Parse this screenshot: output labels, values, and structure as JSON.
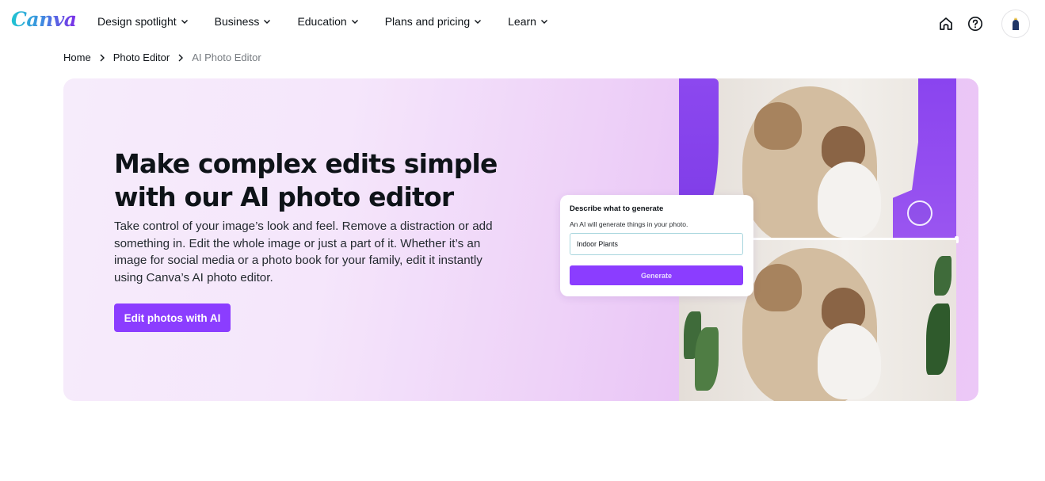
{
  "brand": {
    "logo_text": "Canva",
    "accent_color": "#8b3dff"
  },
  "nav": {
    "items": [
      {
        "label": "Design spotlight"
      },
      {
        "label": "Business"
      },
      {
        "label": "Education"
      },
      {
        "label": "Plans and pricing"
      },
      {
        "label": "Learn"
      }
    ],
    "right_icons": [
      "home-icon",
      "help-icon",
      "avatar"
    ]
  },
  "breadcrumb": {
    "items": [
      {
        "label": "Home"
      },
      {
        "label": "Photo Editor"
      },
      {
        "label": "AI Photo Editor"
      }
    ]
  },
  "hero": {
    "title": "Make complex edits simple with our AI photo editor",
    "description": "Take control of your image’s look and feel. Remove a distraction or add something in. Edit the whole image or just a part of it. Whether it’s an image for social media or a photo book for your family, edit it instantly using Canva’s AI photo editor.",
    "cta_label": "Edit photos with AI"
  },
  "prompt_card": {
    "title": "Describe what to generate",
    "subtitle": "An AI will generate things in your photo.",
    "input_value": "Indoor Plants",
    "button_label": "Generate"
  }
}
